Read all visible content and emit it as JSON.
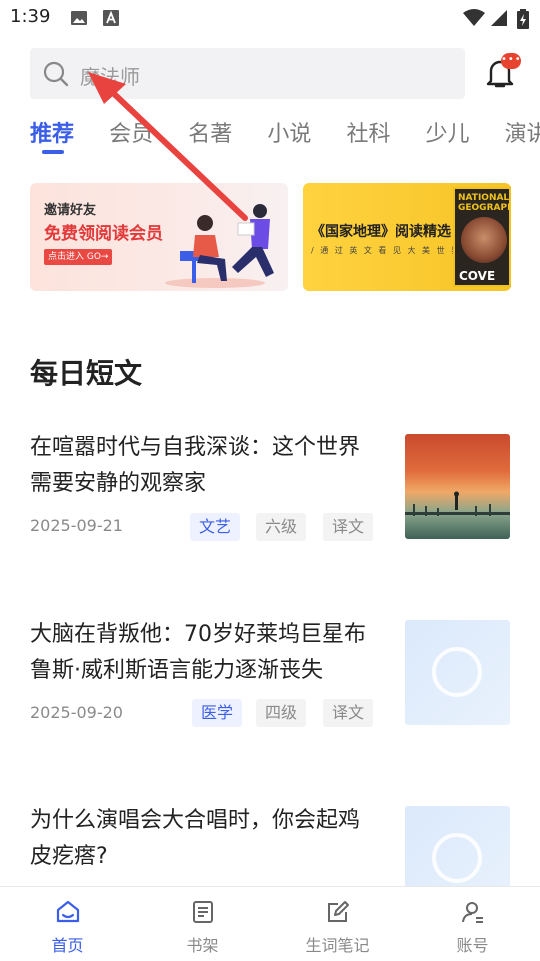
{
  "status_bar": {
    "time": "1:39"
  },
  "search": {
    "placeholder": "魔法师"
  },
  "notifications": {
    "badge": "•••"
  },
  "tabs": [
    {
      "label": "推荐",
      "active": true
    },
    {
      "label": "会员",
      "active": false
    },
    {
      "label": "名著",
      "active": false
    },
    {
      "label": "小说",
      "active": false
    },
    {
      "label": "社科",
      "active": false
    },
    {
      "label": "少儿",
      "active": false
    },
    {
      "label": "演讲",
      "active": false
    }
  ],
  "banners": [
    {
      "line1": "邀请好友",
      "line2": "免费领阅读会员",
      "cta": "点击进入 GO→"
    },
    {
      "line1": "《国家地理》阅读精选",
      "line2": "/ 通 过 英 文 看 见 大 美 世 界 /",
      "magazine_title": "NATIONAL GEOGRAPHIC",
      "magazine_cover": "COVE"
    }
  ],
  "daily": {
    "title": "每日短文",
    "articles": [
      {
        "title": "在喧嚣时代与自我深谈：这个世界需要安静的观察家",
        "date": "2025-09-21",
        "tags": [
          "文艺",
          "六级",
          "译文"
        ]
      },
      {
        "title": "大脑在背叛他：70岁好莱坞巨星布鲁斯·威利斯语言能力逐渐丧失",
        "date": "2025-09-20",
        "tags": [
          "医学",
          "四级",
          "译文"
        ]
      },
      {
        "title": "为什么演唱会大合唱时，你会起鸡皮疙瘩?",
        "date": "",
        "tags": []
      }
    ]
  },
  "bottom_nav": [
    {
      "label": "首页",
      "icon": "home-icon",
      "active": true
    },
    {
      "label": "书架",
      "icon": "bookshelf-icon",
      "active": false
    },
    {
      "label": "生词笔记",
      "icon": "edit-note-icon",
      "active": false
    },
    {
      "label": "账号",
      "icon": "account-icon",
      "active": false
    }
  ],
  "colors": {
    "accent": "#3b5ee8",
    "annotation_arrow": "#e8433f"
  }
}
